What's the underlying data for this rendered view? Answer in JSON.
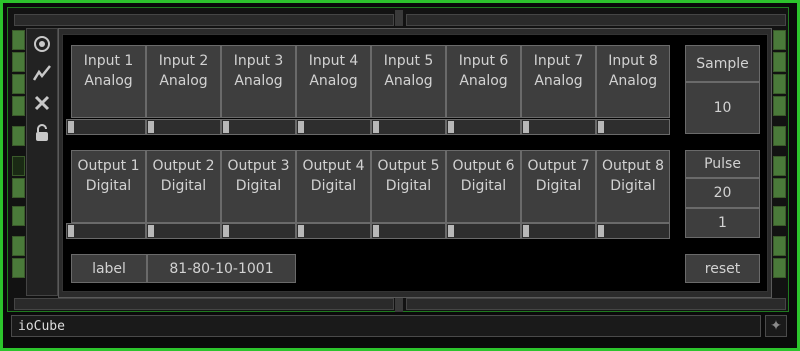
{
  "inputs": [
    {
      "name": "Input 1",
      "type": "Analog"
    },
    {
      "name": "Input 2",
      "type": "Analog"
    },
    {
      "name": "Input 3",
      "type": "Analog"
    },
    {
      "name": "Input 4",
      "type": "Analog"
    },
    {
      "name": "Input 5",
      "type": "Analog"
    },
    {
      "name": "Input 6",
      "type": "Analog"
    },
    {
      "name": "Input 7",
      "type": "Analog"
    },
    {
      "name": "Input 8",
      "type": "Analog"
    }
  ],
  "outputs": [
    {
      "name": "Output 1",
      "type": "Digital"
    },
    {
      "name": "Output 2",
      "type": "Digital"
    },
    {
      "name": "Output 3",
      "type": "Digital"
    },
    {
      "name": "Output 4",
      "type": "Digital"
    },
    {
      "name": "Output 5",
      "type": "Digital"
    },
    {
      "name": "Output 6",
      "type": "Digital"
    },
    {
      "name": "Output 7",
      "type": "Digital"
    },
    {
      "name": "Output 8",
      "type": "Digital"
    }
  ],
  "sample": {
    "label": "Sample",
    "value": "10"
  },
  "pulse": {
    "label": "Pulse",
    "value1": "20",
    "value2": "1"
  },
  "label_field": {
    "label": "label",
    "value": "81-80-10-1001"
  },
  "reset_label": "reset",
  "node_name": "ioCube",
  "sidebar_icons": [
    "target-icon",
    "pulse-icon",
    "close-icon",
    "lock-icon"
  ],
  "colors": {
    "accent": "#2cc42c",
    "port_on": "#4a7a3a"
  }
}
